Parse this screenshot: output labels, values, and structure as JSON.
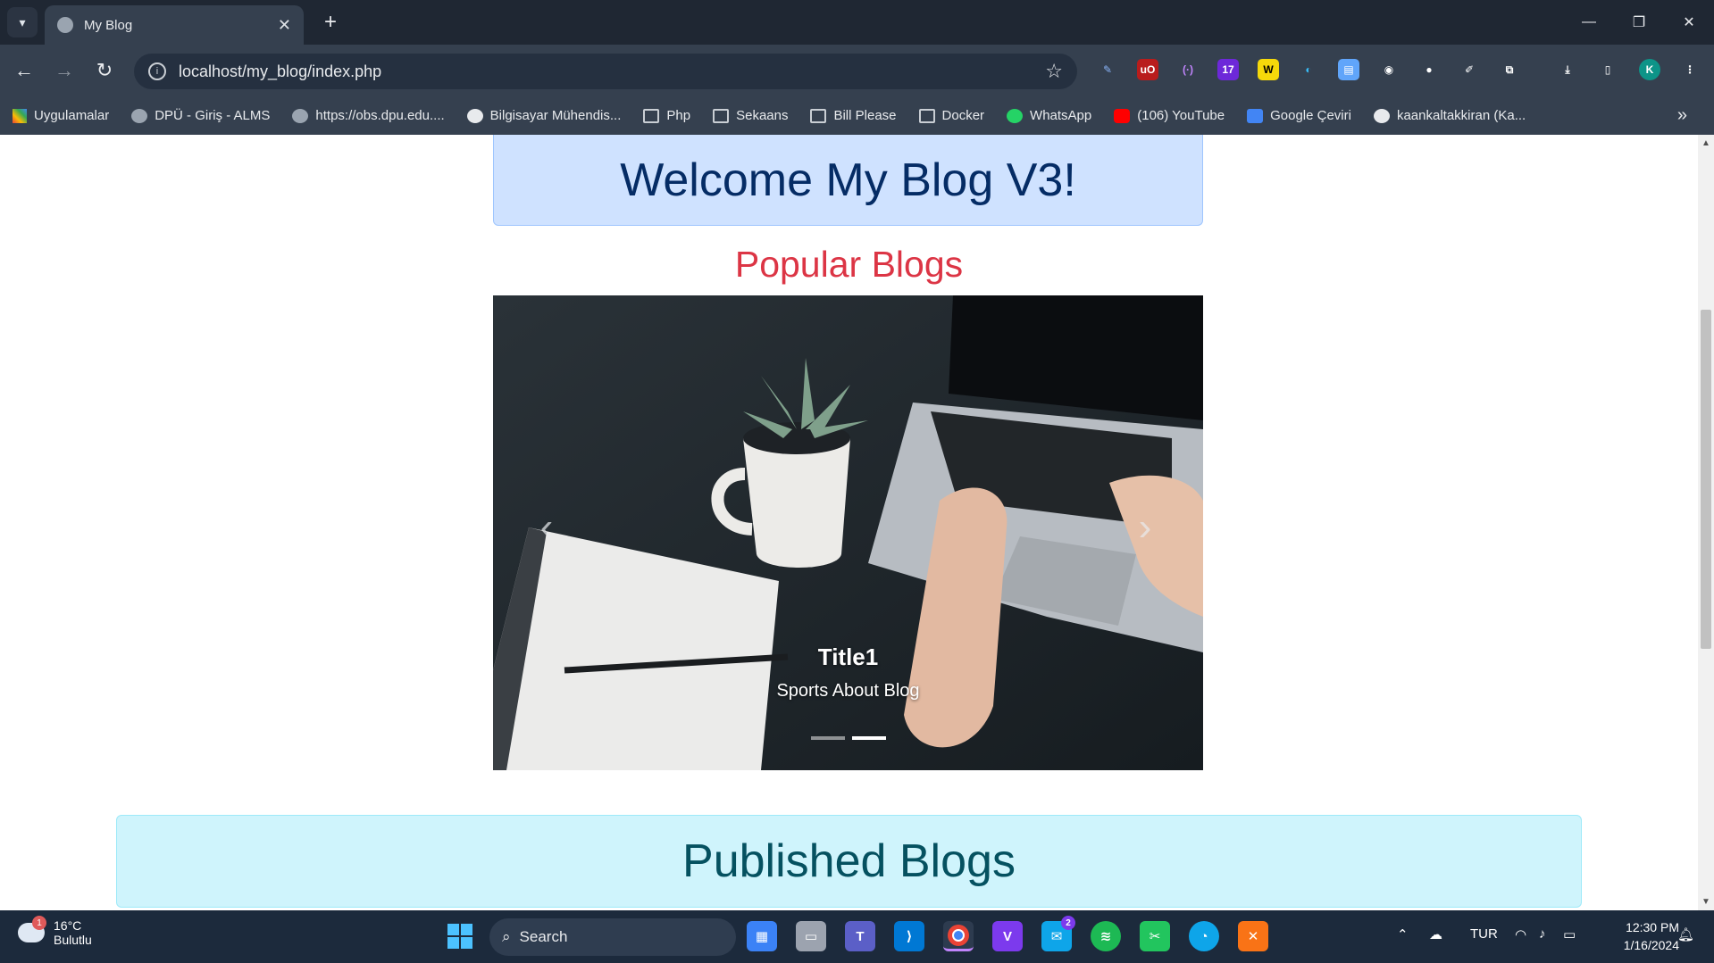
{
  "browser": {
    "tab_title": "My Blog",
    "url": "localhost/my_blog/index.php",
    "bookmarks": [
      "Uygulamalar",
      "DPÜ - Giriş - ALMS",
      "https://obs.dpu.edu....",
      "Bilgisayar Mühendis...",
      "Php",
      "Sekaans",
      "Bill Please",
      "Docker",
      "WhatsApp",
      "(106) YouTube",
      "Google Çeviri",
      "kaankaltakkiran (Ka..."
    ],
    "profile_initial": "K",
    "extension_badge": "17"
  },
  "page": {
    "welcome_title": "Welcome My Blog V3!",
    "popular_heading": "Popular Blogs",
    "carousel": {
      "title": "Title1",
      "text": "Sports About Blog",
      "slide_count": 2,
      "active_index": 1
    },
    "published_heading": "Published Blogs"
  },
  "taskbar": {
    "weather_temp": "16°C",
    "weather_desc": "Bulutlu",
    "weather_badge": "1",
    "search_label": "Search",
    "mail_badge": "2",
    "language": "TUR",
    "time": "12:30 PM",
    "date": "1/16/2024"
  },
  "colors": {
    "welcome_bg": "#cfe2ff",
    "welcome_text": "#052c65",
    "popular_text": "#dc3545",
    "published_bg": "#cff4fc",
    "published_text": "#055160"
  }
}
